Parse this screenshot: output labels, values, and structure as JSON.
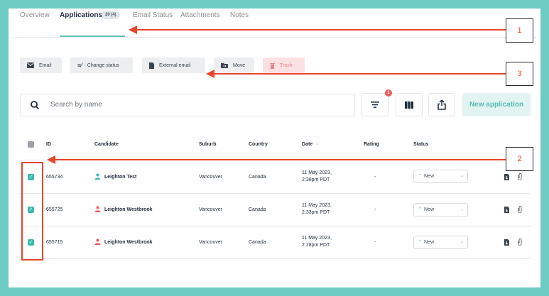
{
  "tabs": [
    {
      "label": "Overview",
      "active": false
    },
    {
      "label": "Applications",
      "active": true,
      "badge": "20 (4)"
    },
    {
      "label": "Email Status",
      "active": false
    },
    {
      "label": "Attachments",
      "active": false
    },
    {
      "label": "Notes",
      "active": false
    }
  ],
  "toolbar": {
    "email": "Email",
    "change_status": "Change status",
    "external_email": "External email",
    "move": "Move",
    "trash": "Trash"
  },
  "search": {
    "placeholder": "Search by name"
  },
  "filter_badge": "1",
  "new_application_label": "New application",
  "table": {
    "headers": {
      "id": "ID",
      "candidate": "Candidate",
      "suburb": "Suburb",
      "country": "Country",
      "date": "Date",
      "date_sort": "↓",
      "rating": "Rating",
      "status": "Status"
    },
    "rows": [
      {
        "id": "655734",
        "candidate": "Leighton Test",
        "suburb": "Vancouver",
        "country": "Canada",
        "date_line1": "11 May 2023,",
        "date_line2": "2:38pm PDT",
        "rating": "-",
        "status": "New",
        "avatar_color": "#3cb8b0"
      },
      {
        "id": "655725",
        "candidate": "Leighton Westbrook",
        "suburb": "Vancouver",
        "country": "Canada",
        "date_line1": "11 May 2023,",
        "date_line2": "2:33pm PDT",
        "rating": "-",
        "status": "New",
        "avatar_color": "#ef5a5a"
      },
      {
        "id": "655715",
        "candidate": "Leighton Westbrook",
        "suburb": "Vancouver",
        "country": "Canada",
        "date_line1": "11 May 2023,",
        "date_line2": "2:28pm PDT",
        "rating": "-",
        "status": "New",
        "avatar_color": "#ef5a5a"
      }
    ]
  },
  "callouts": [
    "1",
    "2",
    "3"
  ],
  "colors": {
    "accent": "#5fc4bb",
    "annotation": "#e8452c",
    "frame": "#6ccbc3"
  }
}
